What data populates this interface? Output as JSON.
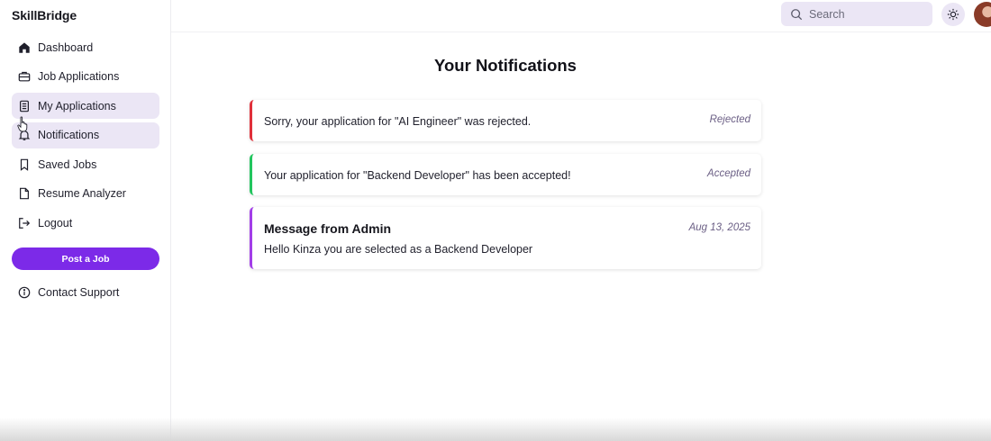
{
  "app": {
    "brand": "SkillBridge"
  },
  "sidebar": {
    "items": [
      {
        "label": "Dashboard",
        "icon": "home-icon"
      },
      {
        "label": "Job Applications",
        "icon": "briefcase-icon"
      },
      {
        "label": "My Applications",
        "icon": "clipboard-icon"
      },
      {
        "label": "Notifications",
        "icon": "bell-icon"
      },
      {
        "label": "Saved Jobs",
        "icon": "bookmark-icon"
      },
      {
        "label": "Resume Analyzer",
        "icon": "file-icon"
      },
      {
        "label": "Logout",
        "icon": "logout-icon"
      }
    ],
    "post_job_label": "Post a Job",
    "contact_label": "Contact Support"
  },
  "header": {
    "search_placeholder": "Search"
  },
  "main": {
    "title": "Your Notifications",
    "notifications": [
      {
        "text": "Sorry, your application for \"AI Engineer\" was rejected.",
        "status": "Rejected",
        "accent": "#e0303a"
      },
      {
        "text": "Your application for \"Backend Developer\" has been accepted!",
        "status": "Accepted",
        "accent": "#22c55e"
      },
      {
        "heading": "Message from Admin",
        "text": "Hello Kinza you are selected as a Backend Developer",
        "date": "Aug 13, 2025",
        "accent": "#a23ee8"
      }
    ]
  },
  "colors": {
    "accent": "#7c2ae8",
    "active_bg": "#ebe6f5"
  }
}
